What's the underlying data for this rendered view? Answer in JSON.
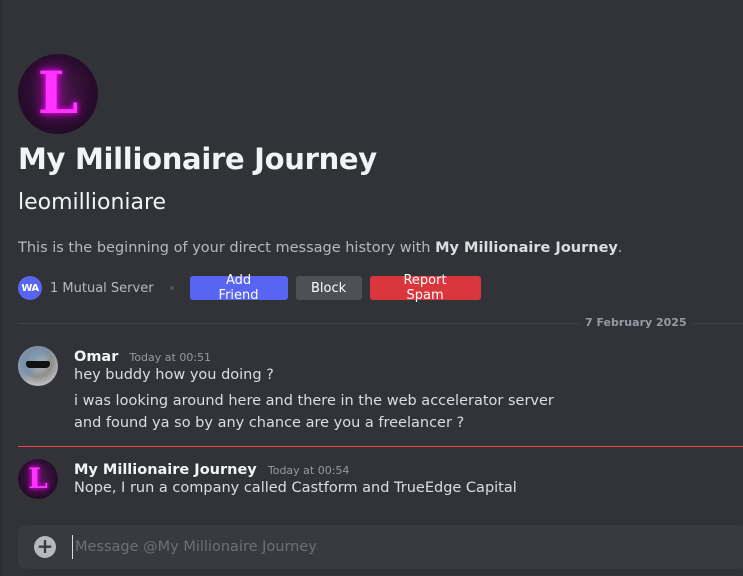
{
  "dm_header": {
    "avatar_letter": "L",
    "title": "My Millionaire Journey",
    "username": "leomillioniare",
    "intro_prefix": "This is the beginning of your direct message history with ",
    "intro_name": "My Millionaire Journey",
    "intro_suffix": "."
  },
  "actions": {
    "server_icon_text": "WA",
    "mutual_servers": "1 Mutual Server",
    "add_friend": "Add Friend",
    "block": "Block",
    "report_spam": "Report Spam"
  },
  "date_divider": "7 February 2025",
  "messages": [
    {
      "author": "Omar",
      "time": "Today at 00:51",
      "lines": [
        "hey buddy how you doing ?",
        "i was looking around here and there in the web accelerator server",
        "and found ya so by any chance are you a freelancer ?"
      ]
    },
    {
      "author": "My Millionaire Journey",
      "avatar_letter": "L",
      "time": "Today at 00:54",
      "lines": [
        "Nope, I run a company called Castform and TrueEdge Capital"
      ]
    }
  ],
  "composer": {
    "placeholder": "Message @My Millionaire Journey",
    "value": ""
  },
  "colors": {
    "background": "#313338",
    "brand": "#5865f2",
    "danger": "#da373c",
    "new_message_line": "#f23f43",
    "avatar_glow": "#ff33ff"
  }
}
